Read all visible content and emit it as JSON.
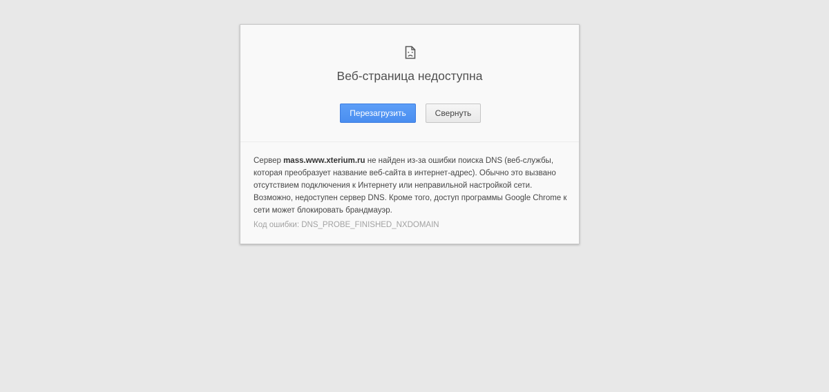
{
  "page": {
    "title": "Веб-страница недоступна",
    "icon": "sad-page-icon"
  },
  "buttons": {
    "reload_label": "Перезагрузить",
    "collapse_label": "Свернуть"
  },
  "details": {
    "prefix": "Сервер ",
    "host": "mass.www.xterium.ru",
    "suffix": " не найден из-за ошибки поиска DNS (веб-службы, которая преобразует название веб-сайта в интернет-адрес). Обычно это вызвано отсутствием подключения к Интернету или неправильной настройкой сети. Возможно, недоступен сервер DNS. Кроме того, доступ программы Google Chrome к сети может блокировать брандмауэр."
  },
  "error": {
    "code_text": "Код ошибки: DNS_PROBE_FINISHED_NXDOMAIN"
  },
  "colors": {
    "background": "#e8e8e8",
    "card": "#f9f9f9",
    "accent_button": "#4a8ef0"
  }
}
